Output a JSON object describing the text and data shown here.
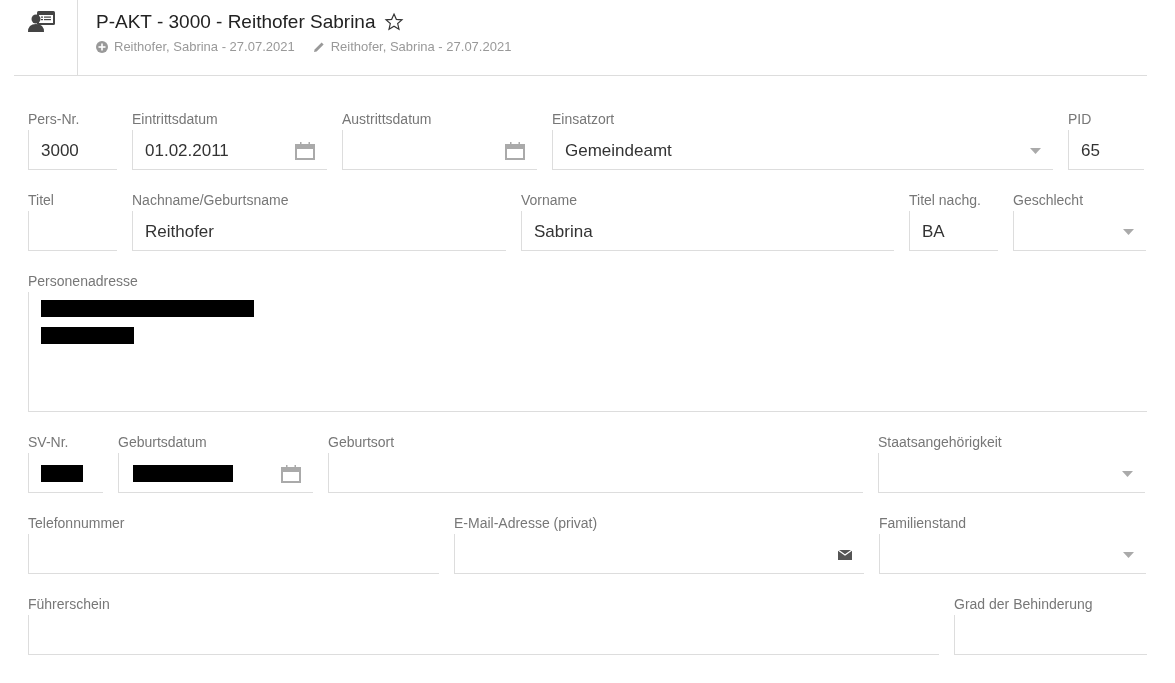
{
  "header": {
    "title": "P-AKT - 3000 - Reithofer Sabrina",
    "favorite": false,
    "created": "Reithofer, Sabrina - 27.07.2021",
    "modified": "Reithofer, Sabrina - 27.07.2021"
  },
  "rows": [
    [
      {
        "label": "Pers-Nr.",
        "kind": "text",
        "value": "3000"
      },
      {
        "label": "Eintrittsdatum",
        "kind": "date",
        "value": "01.02.2011"
      },
      {
        "label": "Austrittsdatum",
        "kind": "date"
      },
      {
        "label": "Einsatzort",
        "kind": "select",
        "value": "Gemeindeamt"
      },
      {
        "label": "PID",
        "kind": "text",
        "value": "65"
      }
    ],
    [
      {
        "label": "Titel",
        "kind": "text"
      },
      {
        "label": "Nachname/Geburtsname",
        "kind": "text",
        "value": "Reithofer"
      },
      {
        "label": "Vorname",
        "kind": "text",
        "value": "Sabrina"
      },
      {
        "label": "Titel nachg.",
        "kind": "text",
        "value": "BA"
      },
      {
        "label": "Geschlecht",
        "kind": "select"
      }
    ],
    [
      {
        "label": "Personenadresse",
        "kind": "textarea",
        "redacted": true
      }
    ],
    [
      {
        "label": "SV-Nr.",
        "kind": "text",
        "redacted": true
      },
      {
        "label": "Geburtsdatum",
        "kind": "date",
        "redacted": true
      },
      {
        "label": "Geburtsort",
        "kind": "text"
      },
      {
        "label": "Staatsangehörigkeit",
        "kind": "select"
      }
    ],
    [
      {
        "label": "Telefonnummer",
        "kind": "text"
      },
      {
        "label": "E-Mail-Adresse (privat)",
        "kind": "email"
      },
      {
        "label": "Familienstand",
        "kind": "select"
      }
    ],
    [
      {
        "label": "Führerschein",
        "kind": "text"
      },
      {
        "label": "Grad der Behinderung",
        "kind": "text"
      }
    ]
  ]
}
